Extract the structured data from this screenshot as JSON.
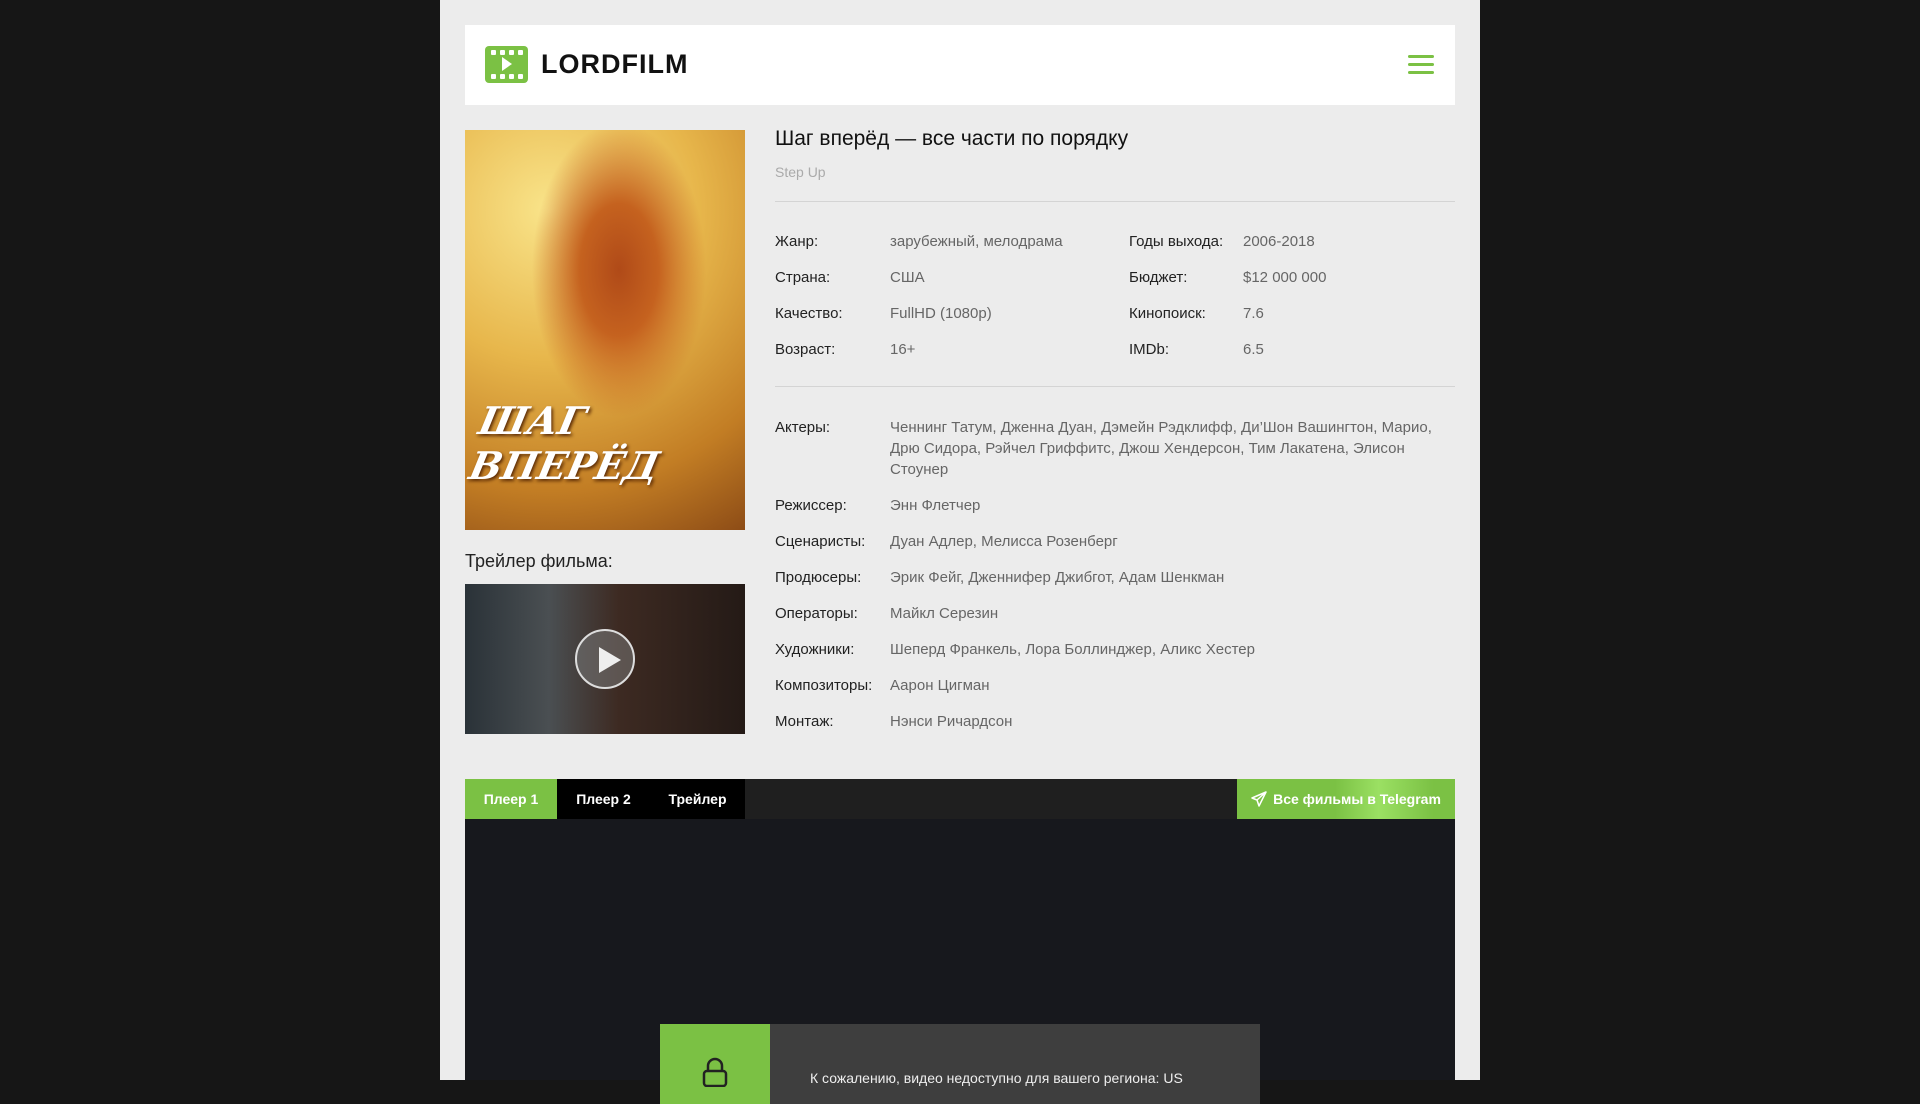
{
  "header": {
    "logo": "LORDFILM"
  },
  "film": {
    "title": "Шаг вперёд — все части по порядку",
    "original_title": "Step Up",
    "poster_text": "ШАГ ВПЕРЁД",
    "info": [
      {
        "label": "Жанр:",
        "value": "зарубежный, мелодрама"
      },
      {
        "label": "Страна:",
        "value": "США"
      },
      {
        "label": "Качество:",
        "value": "FullHD (1080p)"
      },
      {
        "label": "Возраст:",
        "value": "16+"
      },
      {
        "label": "Годы выхода:",
        "value": "2006-2018"
      },
      {
        "label": "Бюджет:",
        "value": "$12 000 000"
      },
      {
        "label": "Кинопоиск:",
        "value": "7.6"
      },
      {
        "label": "IMDb:",
        "value": "6.5"
      }
    ],
    "credits": [
      {
        "label": "Актеры:",
        "value": "Ченнинг Татум, Дженна Дуан, Дэмейн Рэдклифф, Ди’Шон Вашингтон, Марио, Дрю Сидора, Рэйчел Гриффитс, Джош Хендерсон, Тим Лакатена, Элисон Стоунер"
      },
      {
        "label": "Режиссер:",
        "value": "Энн Флетчер"
      },
      {
        "label": "Сценаристы:",
        "value": "Дуан Адлер, Мелисса Розенберг"
      },
      {
        "label": "Продюсеры:",
        "value": "Эрик Фейг, Дженнифер Джибгот, Адам Шенкман"
      },
      {
        "label": "Операторы:",
        "value": "Майкл Серезин"
      },
      {
        "label": "Художники:",
        "value": "Шеперд Франкель, Лора Боллинджер, Аликс Хестер"
      },
      {
        "label": "Композиторы:",
        "value": "Аарон Цигман"
      },
      {
        "label": "Монтаж:",
        "value": "Нэнси Ричардсон"
      }
    ]
  },
  "trailer": {
    "label": "Трейлер фильма:"
  },
  "player": {
    "tabs": [
      "Плеер 1",
      "Плеер 2",
      "Трейлер"
    ],
    "telegram": "Все фильмы в Telegram",
    "message": "К сожалению, видео недоступно для вашего региона: US"
  },
  "colors": {
    "accent": "#7bc144"
  }
}
